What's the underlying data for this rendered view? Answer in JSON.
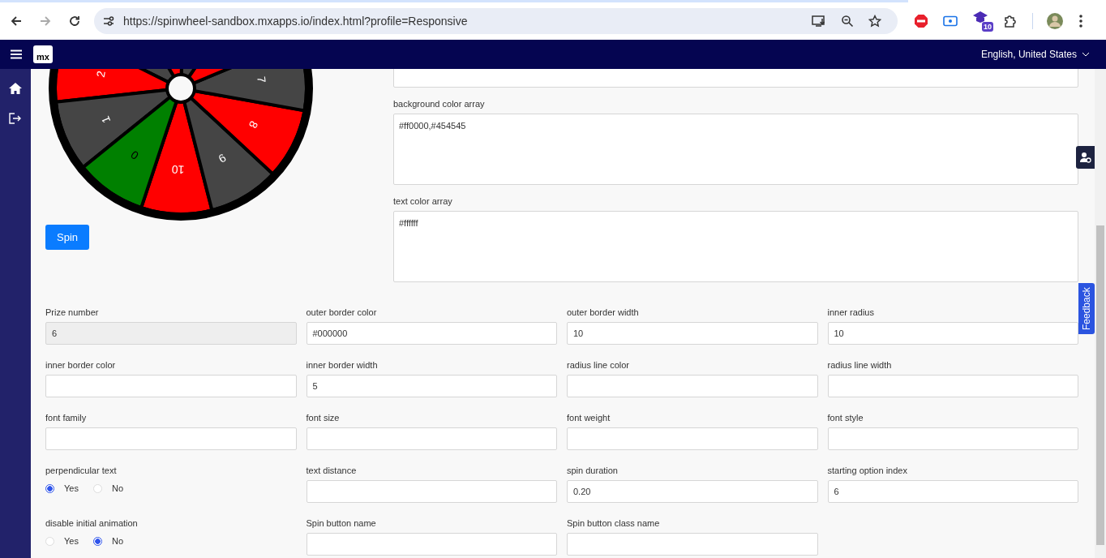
{
  "browser": {
    "url": "https://spinwheel-sandbox.mxapps.io/index.html?profile=Responsive",
    "extension_badge": "10"
  },
  "header": {
    "logo": "mx",
    "language": "English, United States"
  },
  "wheel": {
    "segments": [
      {
        "label": "10",
        "color": "#ff0000"
      },
      {
        "label": "9",
        "color": "#454545"
      },
      {
        "label": "8",
        "color": "#ff0000"
      },
      {
        "label": "7",
        "color": "#454545"
      },
      {
        "color": "#ff0000"
      },
      {
        "color": "#454545"
      },
      {
        "color": "#ff0000"
      },
      {
        "color": "#454545"
      },
      {
        "label": "2",
        "color": "#ff0000"
      },
      {
        "label": "1",
        "color": "#454545"
      },
      {
        "label": "0",
        "color": "#008000"
      }
    ],
    "spin_button": "Spin"
  },
  "text_areas": [
    {
      "label": "background color array",
      "value": "#ff0000,#454545"
    },
    {
      "label": "text color array",
      "value": "#ffffff"
    }
  ],
  "fields": [
    {
      "kind": "input",
      "label": "Prize number",
      "value": "6",
      "disabled": true
    },
    {
      "kind": "input",
      "label": "outer border color",
      "value": "#000000",
      "disabled": false
    },
    {
      "kind": "input",
      "label": "outer border width",
      "value": "10",
      "disabled": false
    },
    {
      "kind": "input",
      "label": "inner radius",
      "value": "10",
      "disabled": false
    },
    {
      "kind": "input",
      "label": "inner border color",
      "disabled": false
    },
    {
      "kind": "input",
      "label": "inner border width",
      "value": "5",
      "disabled": false
    },
    {
      "kind": "input",
      "label": "radius line color",
      "disabled": false
    },
    {
      "kind": "input",
      "label": "radius line width",
      "disabled": false
    },
    {
      "kind": "input",
      "label": "font family",
      "disabled": false
    },
    {
      "kind": "input",
      "label": "font size",
      "disabled": false
    },
    {
      "kind": "input",
      "label": "font weight",
      "disabled": false
    },
    {
      "kind": "input",
      "label": "font style",
      "disabled": false
    },
    {
      "kind": "radio",
      "label": "perpendicular text",
      "options": [
        {
          "label": "Yes",
          "selected": true
        },
        {
          "label": "No",
          "selected": false
        }
      ]
    },
    {
      "kind": "input",
      "label": "text distance",
      "disabled": false
    },
    {
      "kind": "input",
      "label": "spin duration",
      "value": "0.20",
      "disabled": false
    },
    {
      "kind": "input",
      "label": "starting option index",
      "value": "6",
      "disabled": false
    },
    {
      "kind": "radio",
      "label": "disable initial animation",
      "options": [
        {
          "label": "Yes",
          "selected": false
        },
        {
          "label": "No",
          "selected": true
        }
      ]
    },
    {
      "kind": "input",
      "label": "Spin button name",
      "disabled": false
    },
    {
      "kind": "input",
      "label": "Spin button class name",
      "disabled": false
    }
  ],
  "feedback_tab": "Feedback"
}
